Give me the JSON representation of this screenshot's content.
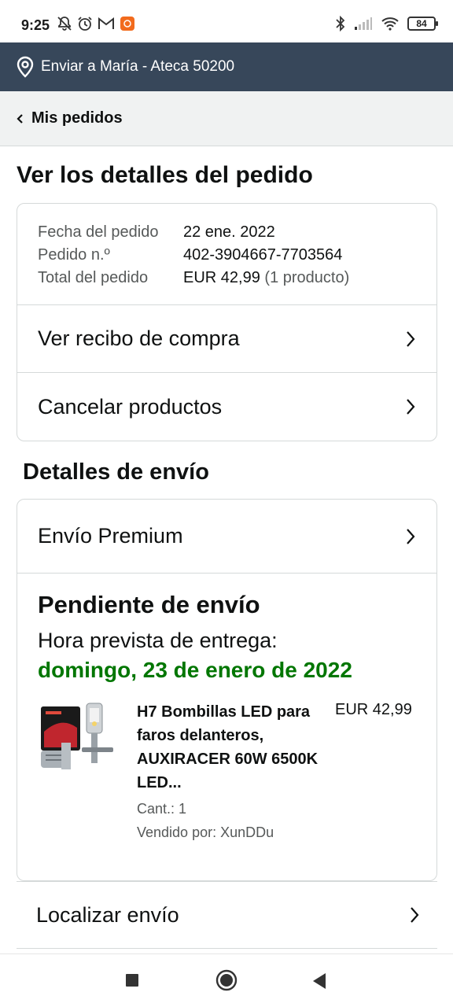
{
  "status_bar": {
    "time": "9:25",
    "battery": "84",
    "icons": [
      "notifications-off-icon",
      "alarm-icon",
      "gmail-icon",
      "app-notification-icon",
      "bluetooth-icon",
      "signal-icon",
      "wifi-icon",
      "battery-icon"
    ]
  },
  "address": {
    "text": "Enviar a María - Ateca 50200",
    "icon": "location-pin-icon"
  },
  "breadcrumb": {
    "label": "Mis pedidos"
  },
  "page_title": "Ver los detalles del pedido",
  "order_summary": {
    "date_label": "Fecha del pedido",
    "date_value": "22 ene. 2022",
    "number_label": "Pedido n.º",
    "number_value": "402-3904667-7703564",
    "total_label": "Total del pedido",
    "total_value": "EUR 42,99",
    "total_count": "(1 producto)"
  },
  "actions": {
    "receipt": "Ver recibo de compra",
    "cancel": "Cancelar productos"
  },
  "shipping": {
    "section_title": "Detalles de envío",
    "method": "Envío Premium",
    "status": "Pendiente de envío",
    "eta_label": "Hora prevista de entrega:",
    "eta_date": "domingo, 23 de enero de 2022",
    "eta_color": "#007600",
    "item": {
      "title": "H7 Bombillas LED para faros delanteros, AUXIRACER 60W 6500K LED...",
      "quantity": "Cant.: 1",
      "seller": "Vendido por: XunDDu",
      "price": "EUR 42,99"
    },
    "track": "Localizar envío"
  },
  "colors": {
    "header_bg": "#37475a",
    "breadcrumb_bg": "#f0f2f2",
    "border": "#d5d9d9"
  }
}
